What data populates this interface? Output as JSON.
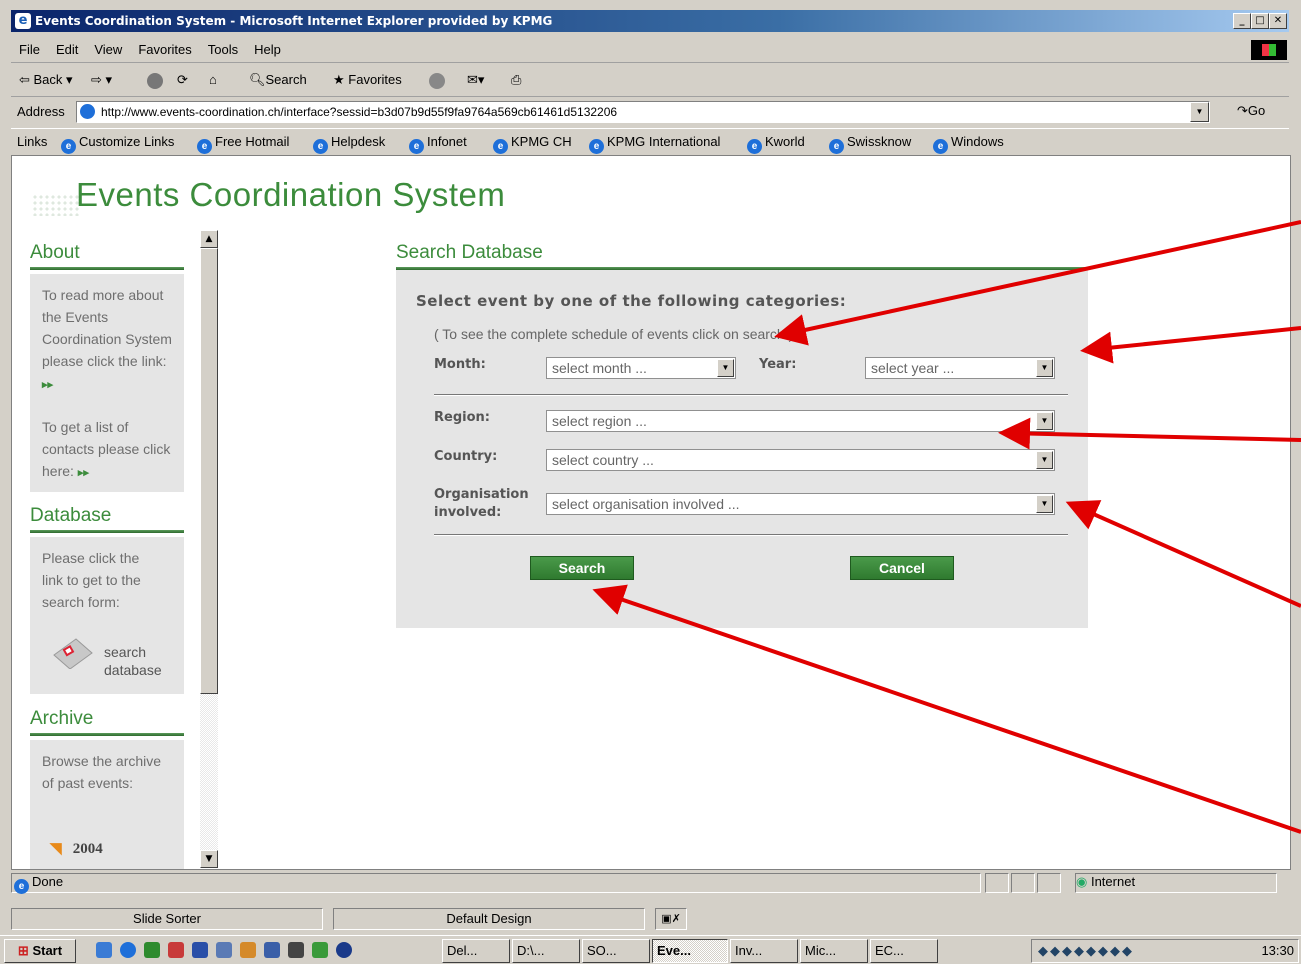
{
  "window": {
    "title": "Events Coordination System - Microsoft Internet Explorer provided by KPMG"
  },
  "menu": [
    "File",
    "Edit",
    "View",
    "Favorites",
    "Tools",
    "Help"
  ],
  "toolbar": {
    "back": "Back",
    "search": "Search",
    "favorites": "Favorites"
  },
  "address": {
    "label": "Address",
    "url": "http://www.events-coordination.ch/interface?sessid=b3d07b9d55f9fa9764a569cb61461d5132206",
    "go": "Go"
  },
  "links": {
    "label": "Links",
    "items": [
      "Customize Links",
      "Free Hotmail",
      "Helpdesk",
      "Infonet",
      "KPMG CH",
      "KPMG International",
      "Kworld",
      "Swissknow",
      "Windows"
    ]
  },
  "site": {
    "title": "Events Coordination System"
  },
  "sidebar": {
    "about": {
      "title": "About",
      "text1": "To read more about the Events Coordination System please click the link:",
      "text2": "To get a list of contacts please click here:"
    },
    "database": {
      "title": "Database",
      "text": "Please click the link to get to the search form:",
      "link_line1": "search",
      "link_line2": "database"
    },
    "archive": {
      "title": "Archive",
      "text": "Browse the archive of past events:",
      "year": "2004"
    }
  },
  "search": {
    "title": "Search Database",
    "heading": "Select event by one of the following categories:",
    "note": "( To see the complete schedule of events click on search )",
    "month_label": "Month:",
    "month_placeholder": "select month ...",
    "year_label": "Year:",
    "year_placeholder": "select year ...",
    "region_label": "Region:",
    "region_placeholder": "select region ...",
    "country_label": "Country:",
    "country_placeholder": "select country ...",
    "org_label_line1": "Organisation",
    "org_label_line2": "involved:",
    "org_placeholder": "select organisation involved ...",
    "search_button": "Search",
    "cancel_button": "Cancel"
  },
  "status": {
    "text": "Done",
    "zone": "Internet"
  },
  "powerpoint": {
    "view": "Slide Sorter",
    "design": "Default Design"
  },
  "taskbar": {
    "start": "Start",
    "tasks": [
      "Del...",
      "D:\\...",
      "SO...",
      "Eve...",
      "Inv...",
      "Mic...",
      "EC..."
    ],
    "clock": "13:30"
  },
  "colors": {
    "brand_green": "#3c8c3c",
    "panel_gray": "#e5e5e5",
    "annotation_red": "#e00000"
  }
}
